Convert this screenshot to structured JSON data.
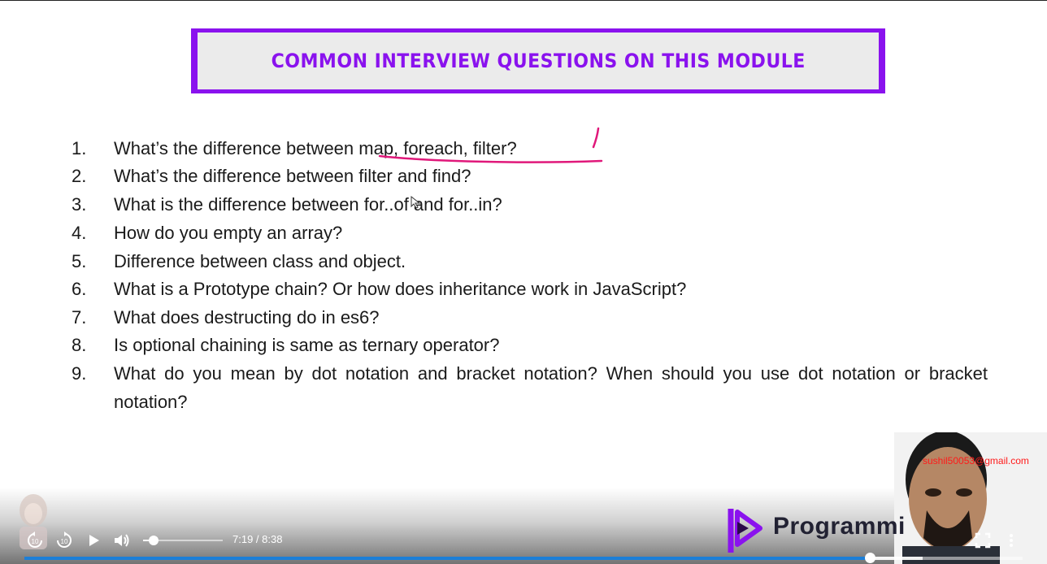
{
  "banner": {
    "title": "COMMON INTERVIEW QUESTIONS ON THIS MODULE"
  },
  "questions": [
    {
      "num": "1.",
      "text": "What’s the difference between map, foreach, filter?"
    },
    {
      "num": "2.",
      "text": "What’s the difference between filter and find?"
    },
    {
      "num": "3.",
      "text": "What is the difference between for..of and for..in?"
    },
    {
      "num": "4.",
      "text": "How do you empty an array?"
    },
    {
      "num": "5.",
      "text": "Difference between class and object."
    },
    {
      "num": "6.",
      "text": "What is a Prototype chain? Or how does inheritance work in JavaScript?"
    },
    {
      "num": "7.",
      "text": "What does destructing do in es6?"
    },
    {
      "num": "8.",
      "text": "Is optional chaining is same as ternary operator?"
    },
    {
      "num": "9.",
      "text": "What do you mean by dot notation and bracket notation? When should you use dot notation or bracket notation?"
    }
  ],
  "overlay": {
    "email": "sushil50053@gmail.com",
    "brand": "Programmi"
  },
  "player": {
    "time": "7:19 / 8:38",
    "rewind_seconds": "10",
    "forward_seconds": "10",
    "volume_level": 0.13,
    "progress_fraction": 0.8468,
    "buffered_fraction": 0.9,
    "accent_color": "#1c7fd8"
  },
  "colors": {
    "banner_accent": "#8a12ee",
    "annotation": "#e0187a"
  }
}
